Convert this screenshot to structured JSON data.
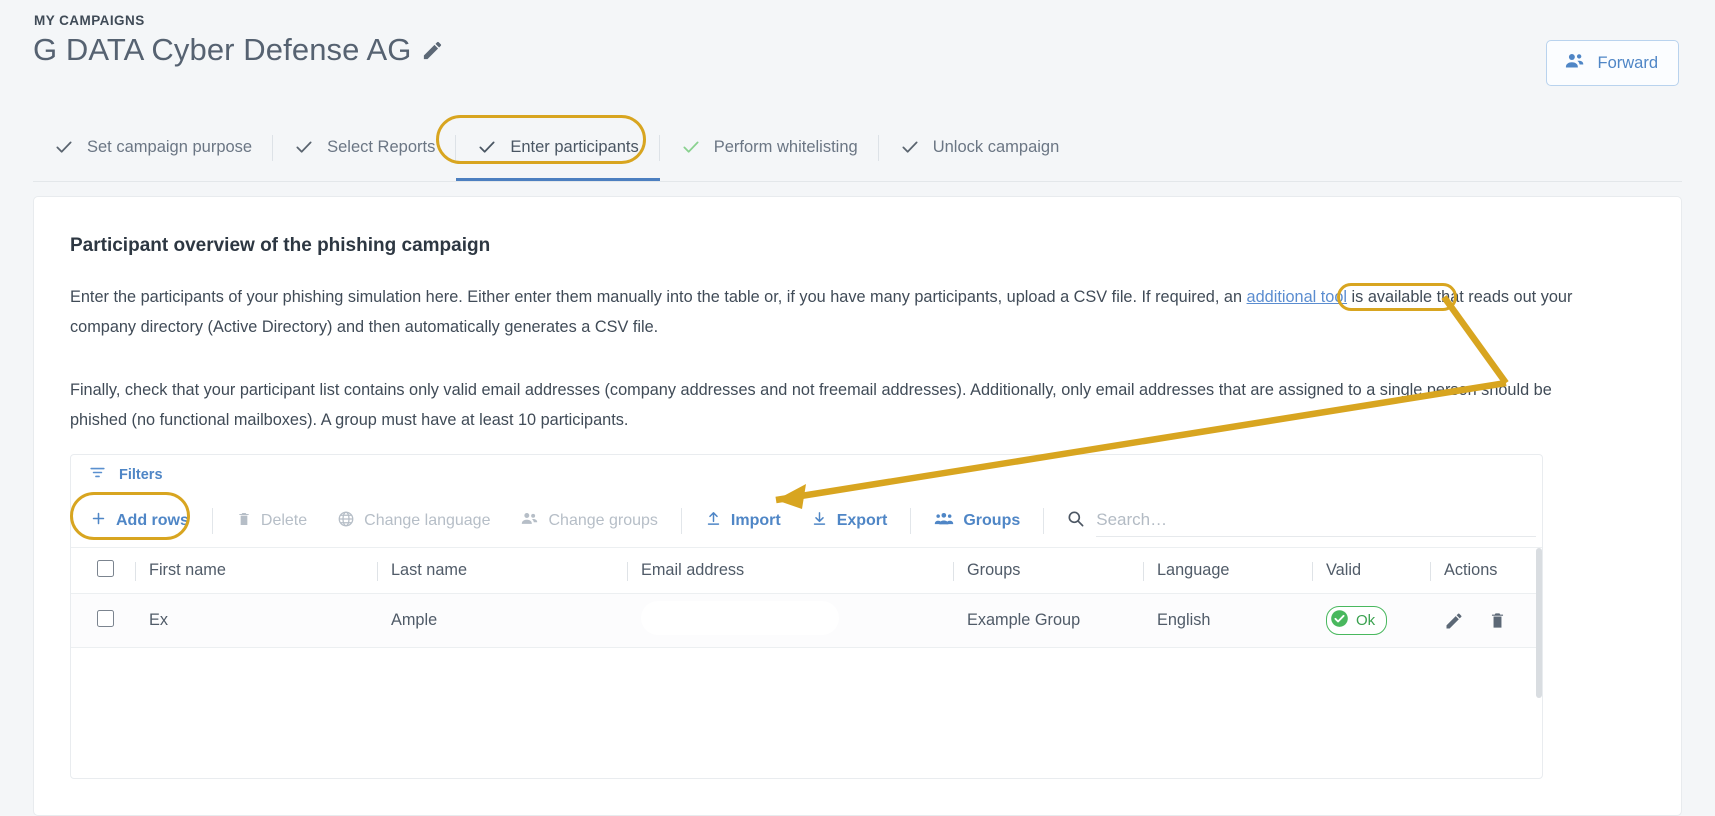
{
  "header": {
    "eyebrow": "MY CAMPAIGNS",
    "title": "G DATA Cyber Defense AG",
    "edit_icon": "pencil-icon",
    "forward_label": "Forward",
    "forward_icon": "people-icon"
  },
  "steps": [
    {
      "label": "Set campaign purpose",
      "check": "check-icon",
      "state": "done"
    },
    {
      "label": "Select Reports",
      "check": "check-icon",
      "state": "done"
    },
    {
      "label": "Enter participants",
      "check": "check-icon",
      "state": "active"
    },
    {
      "label": "Perform whitelisting",
      "check": "check-icon",
      "state": "green"
    },
    {
      "label": "Unlock campaign",
      "check": "check-icon",
      "state": "done"
    }
  ],
  "card": {
    "title": "Participant overview of the phishing campaign",
    "paragraph_1_a": "Enter the participants of your phishing simulation here. Either enter them manually into the table or, if you have many participants, upload a CSV file. If required, an ",
    "paragraph_1_link": "additional tool",
    "paragraph_1_b": " is available that reads out your company directory (Active Directory) and then automatically generates a CSV file.",
    "paragraph_2": "Finally, check that your participant list contains only valid email addresses (company addresses and not freemail addresses). Additionally, only email addresses that are assigned to a single person should be phished (no functional mailboxes). A group must have at least 10 participants."
  },
  "toolbar": {
    "filters_label": "Filters",
    "filters_icon": "filter-icon",
    "add_rows_label": "Add rows",
    "add_rows_icon": "plus-icon",
    "delete_label": "Delete",
    "delete_icon": "trash-icon",
    "change_language_label": "Change language",
    "change_language_icon": "globe-icon",
    "change_groups_label": "Change groups",
    "change_groups_icon": "people-icon",
    "import_label": "Import",
    "import_icon": "upload-icon",
    "export_label": "Export",
    "export_icon": "download-icon",
    "groups_label": "Groups",
    "groups_icon": "people-group-icon",
    "search_placeholder": "Search…",
    "search_value": "",
    "search_icon": "search-icon"
  },
  "table": {
    "columns": [
      "First name",
      "Last name",
      "Email address",
      "Groups",
      "Language",
      "Valid",
      "Actions"
    ],
    "rows": [
      {
        "first_name": "Ex",
        "last_name": "Ample",
        "email": "",
        "group": "Example Group",
        "language": "English",
        "valid": "Ok",
        "edit_icon": "pencil-icon",
        "delete_icon": "trash-icon"
      }
    ]
  },
  "colors": {
    "accent_blue": "#4f86c6",
    "annotation": "#d8a520",
    "valid_green": "#3aa14f",
    "page_bg": "#f4f6f8"
  }
}
